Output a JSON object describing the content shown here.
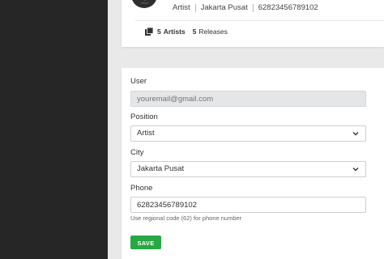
{
  "profile": {
    "role": "Artist",
    "city": "Jakarta Pusat",
    "phone": "62823456789102",
    "stats": {
      "artists_count": "5",
      "artists_label": "Artists",
      "releases_count": "5",
      "releases_label": "Releases"
    }
  },
  "form": {
    "user": {
      "label": "User",
      "placeholder": "youremail@gmail.com"
    },
    "position": {
      "label": "Position",
      "value": "Artist"
    },
    "city": {
      "label": "City",
      "value": "Jakarta Pusat"
    },
    "phone": {
      "label": "Phone",
      "value": "62823456789102",
      "hint": "Use regional code (62) for phone number"
    },
    "save_label": "SAVE"
  },
  "colors": {
    "sidebar": "#262626",
    "save_button": "#28a745",
    "page_background": "#e9e9e9"
  },
  "icons": {
    "avatar": "avatar-image",
    "stats": "library-icon",
    "select": "chevron-down-icon"
  }
}
